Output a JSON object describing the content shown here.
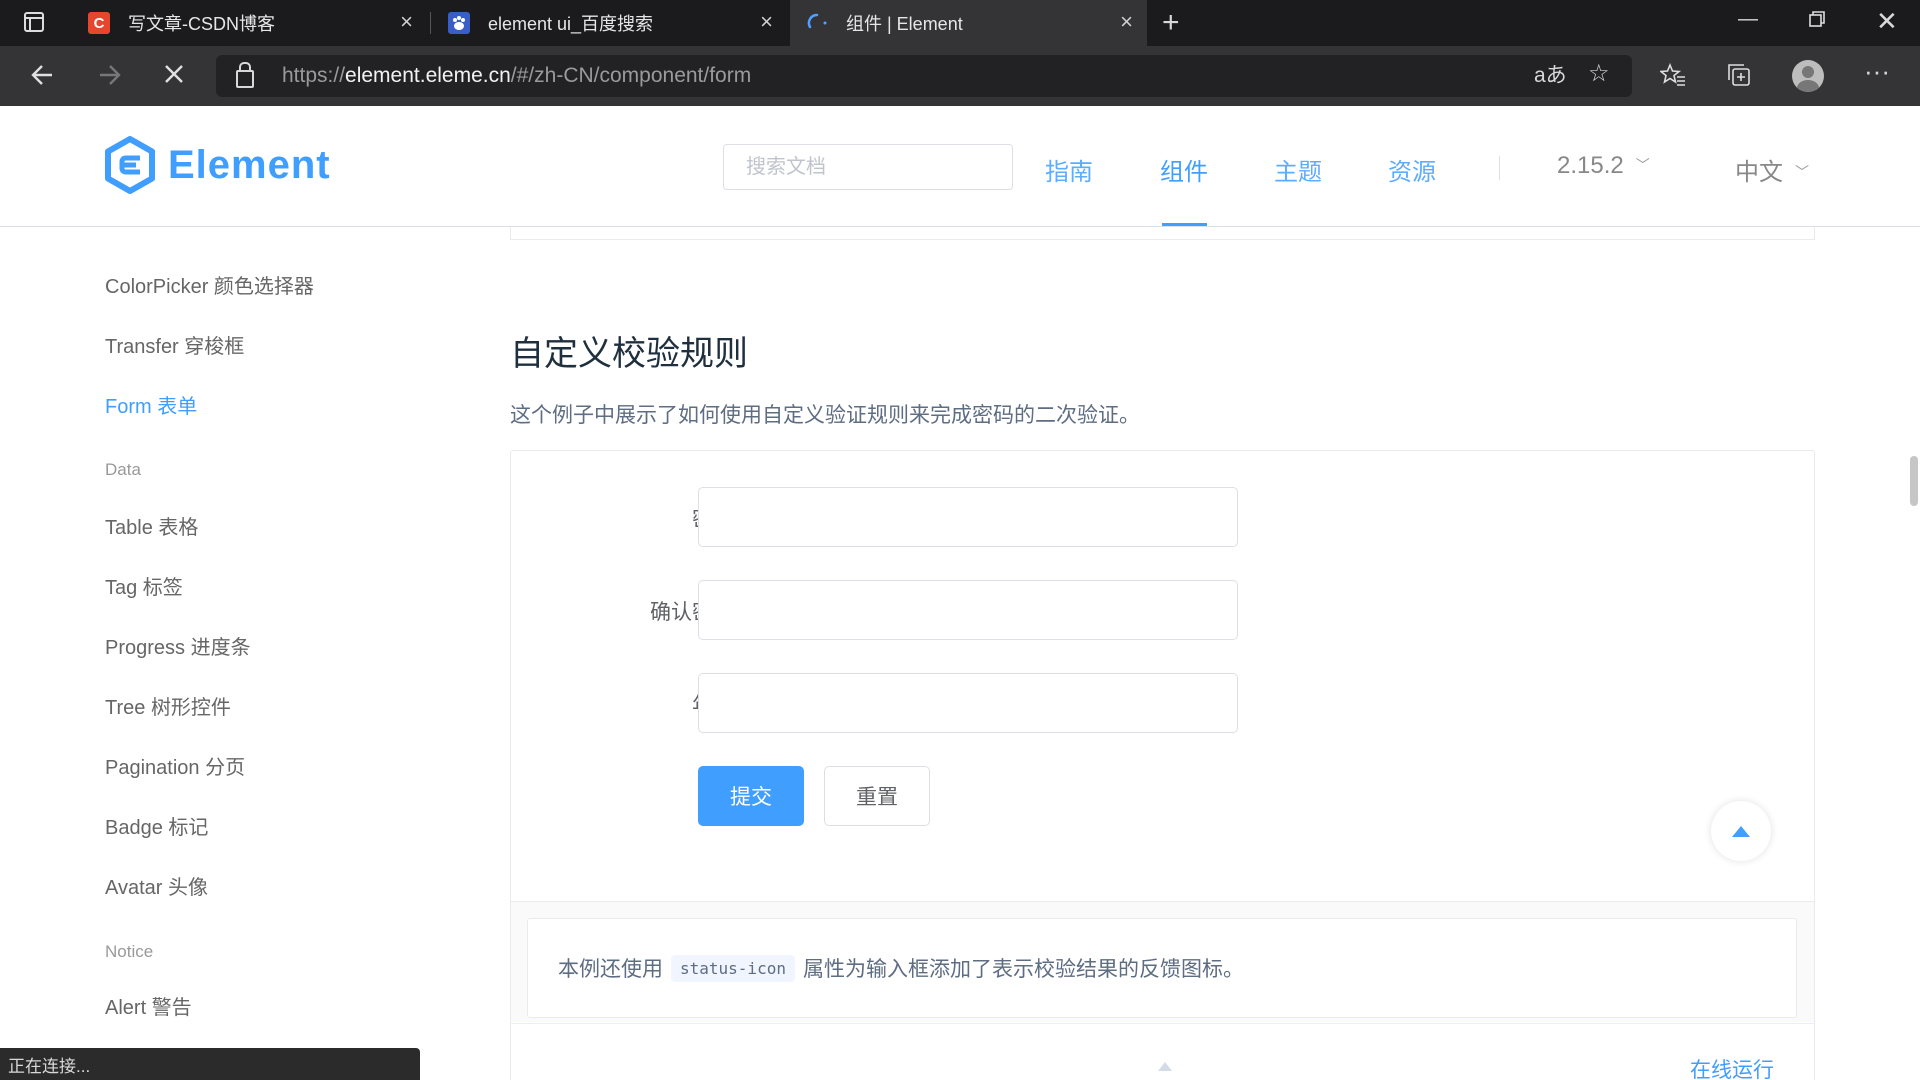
{
  "browser": {
    "tabs": [
      {
        "title": "写文章-CSDN博客",
        "favicon": "csdn-icon"
      },
      {
        "title": "element ui_百度搜索",
        "favicon": "baidu-icon"
      },
      {
        "title": "组件 | Element",
        "favicon": "loading-icon"
      }
    ],
    "url_prefix": "https://",
    "url_host": "element.eleme.cn",
    "url_path": "/#/zh-CN/component/form",
    "status": "正在连接..."
  },
  "header": {
    "logo_text": "Element",
    "search_placeholder": "搜索文档",
    "nav": [
      {
        "label": "指南"
      },
      {
        "label": "组件",
        "active": true
      },
      {
        "label": "主题"
      },
      {
        "label": "资源"
      }
    ],
    "version": "2.15.2",
    "language": "中文",
    "accent_color": "#409eff"
  },
  "sidebar": {
    "items": [
      {
        "label": "ColorPicker 颜色选择器"
      },
      {
        "label": "Transfer 穿梭框"
      },
      {
        "label": "Form 表单",
        "active": true
      }
    ],
    "group_data": "Data",
    "data_items": [
      {
        "label": "Table 表格"
      },
      {
        "label": "Tag 标签"
      },
      {
        "label": "Progress 进度条"
      },
      {
        "label": "Tree 树形控件"
      },
      {
        "label": "Pagination 分页"
      },
      {
        "label": "Badge 标记"
      },
      {
        "label": "Avatar 头像"
      }
    ],
    "group_notice": "Notice",
    "notice_items": [
      {
        "label": "Alert 警告"
      }
    ]
  },
  "content": {
    "title": "自定义校验规则",
    "description": "这个例子中展示了如何使用自定义验证规则来完成密码的二次验证。",
    "form": {
      "fields": [
        {
          "label": "密码",
          "value": ""
        },
        {
          "label": "确认密码",
          "value": ""
        },
        {
          "label": "年龄",
          "value": ""
        }
      ],
      "submit_label": "提交",
      "reset_label": "重置"
    },
    "note_before": "本例还使用",
    "note_code": "status-icon",
    "note_after": "属性为输入框添加了表示校验结果的反馈图标。",
    "run_online": "在线运行"
  }
}
